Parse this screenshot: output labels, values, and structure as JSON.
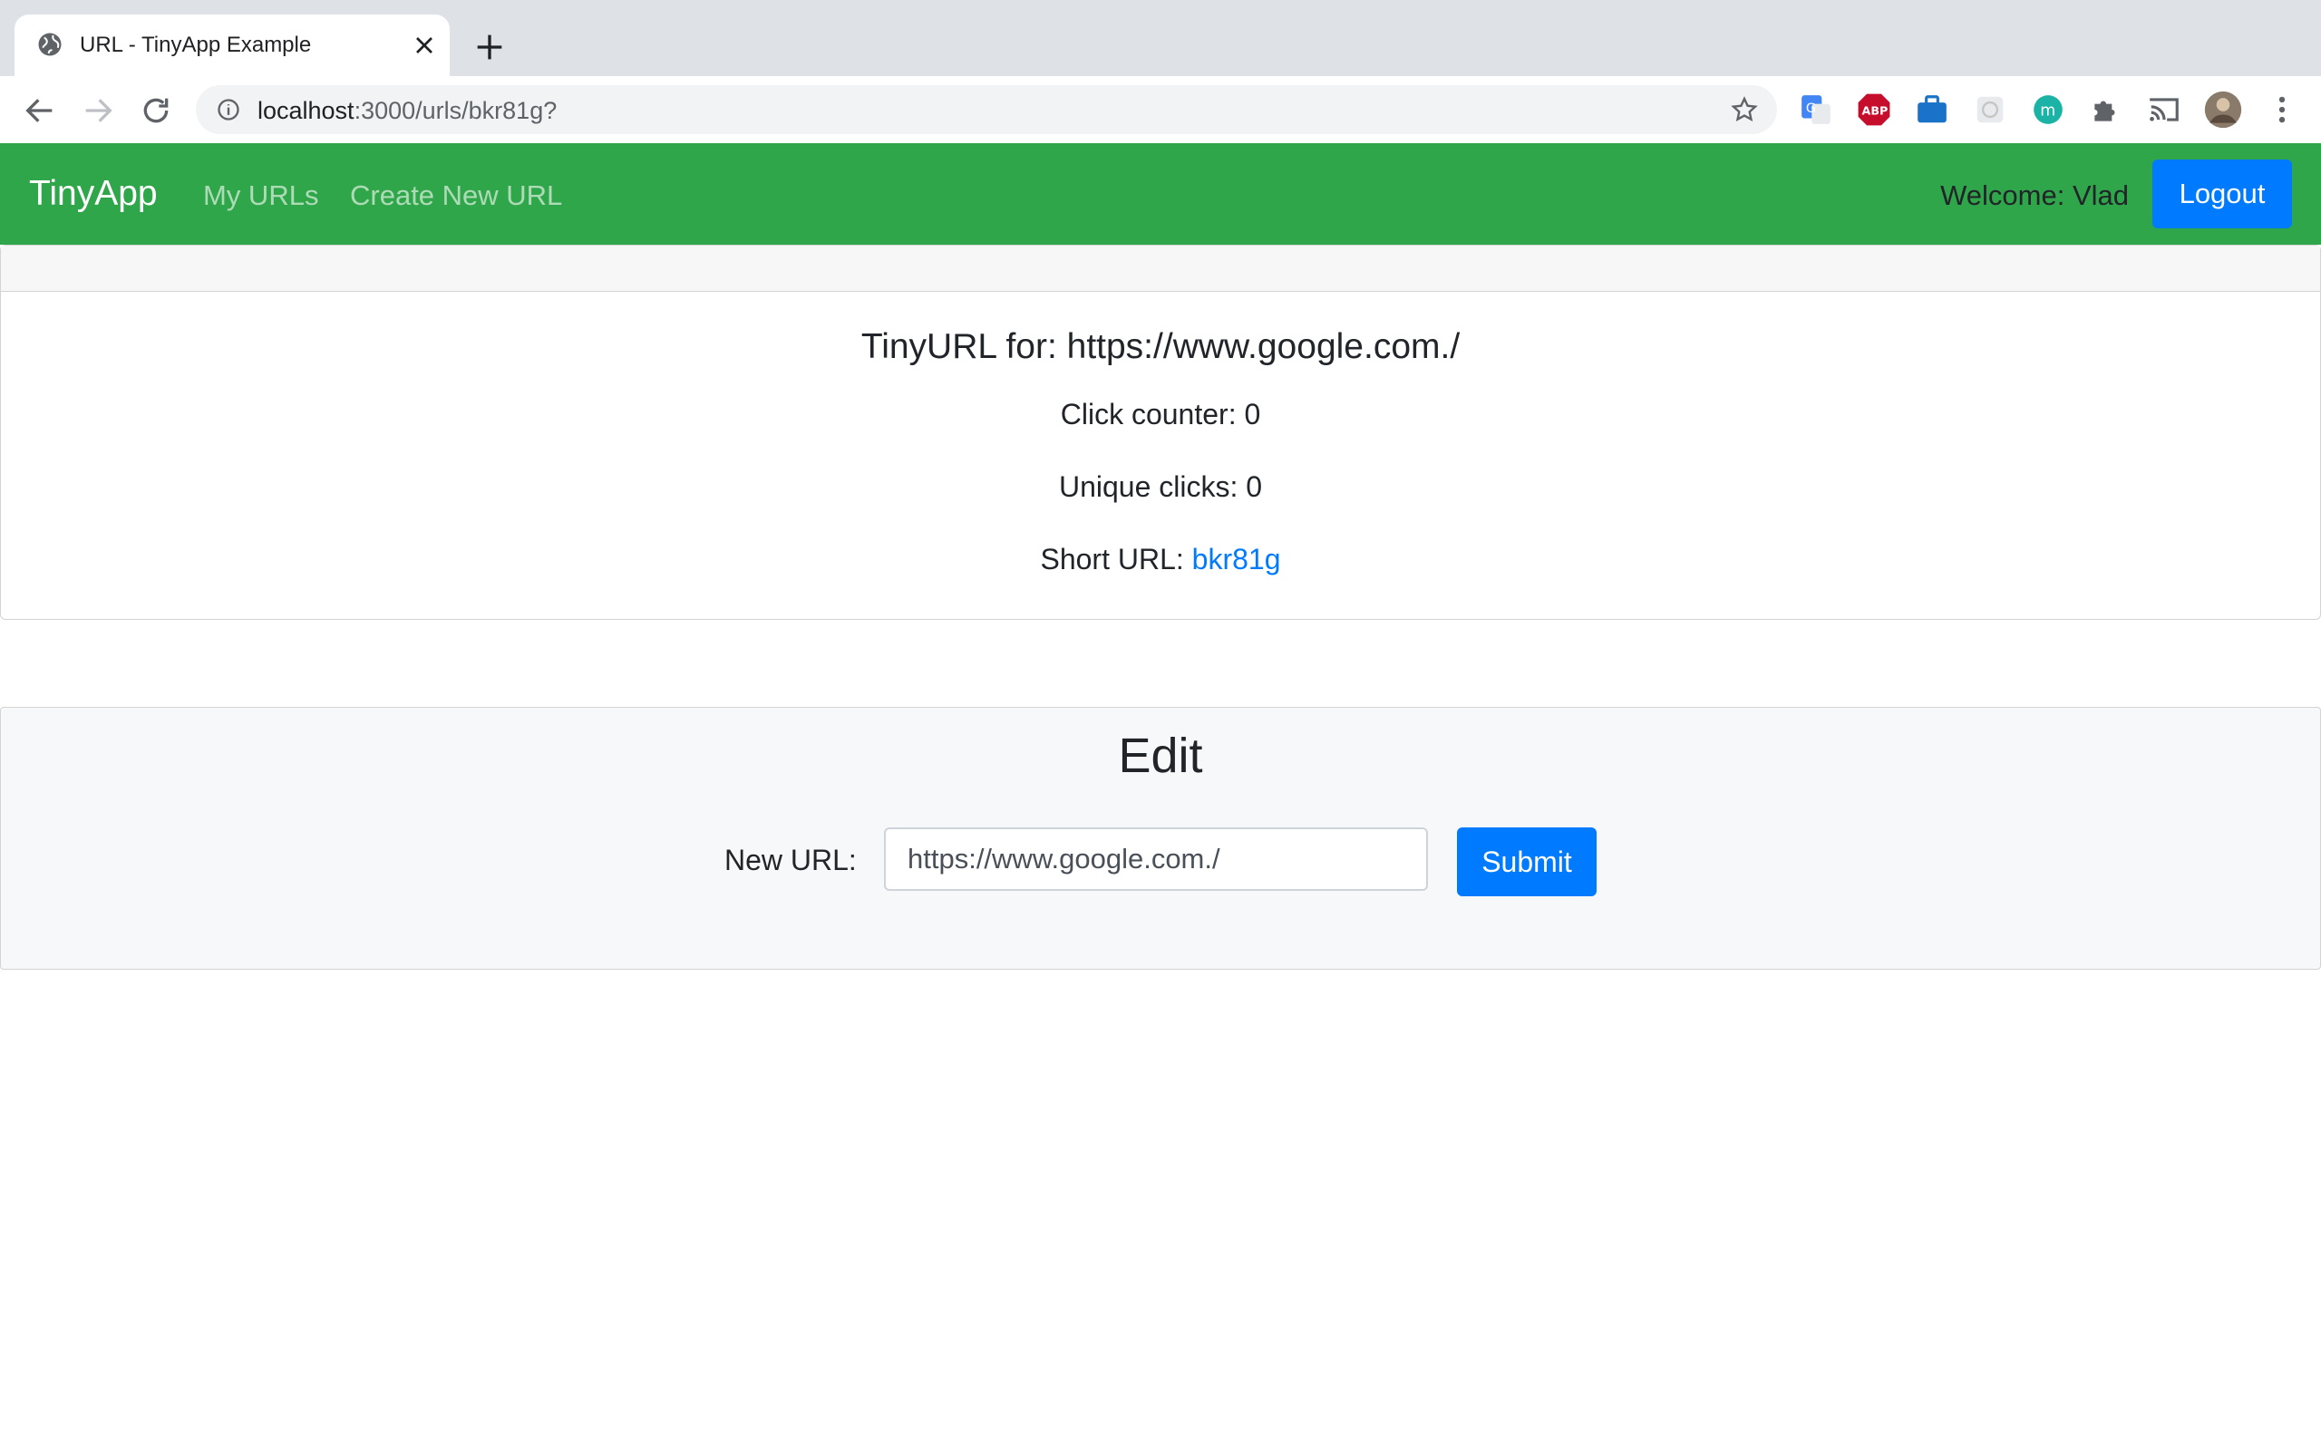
{
  "browser": {
    "tab": {
      "title": "URL - TinyApp Example",
      "favicon": "globe-icon"
    },
    "address": {
      "host": "localhost",
      "path": ":3000/urls/bkr81g?"
    },
    "extensions": [
      "google-translate-icon",
      "adblock-plus-icon",
      "toolbox-icon",
      "grid-icon",
      "m-extension-icon",
      "puzzle-icon",
      "cast-icon",
      "avatar",
      "more-vert-icon"
    ]
  },
  "navbar": {
    "brand": "TinyApp",
    "links": [
      "My URLs",
      "Create New URL"
    ],
    "welcome": "Welcome: Vlad",
    "logout_label": "Logout",
    "color": "#30a64a"
  },
  "card": {
    "title": "TinyURL for: https://www.google.com./",
    "click_counter": "Click counter: 0",
    "unique_clicks": "Unique clicks: 0",
    "short_url_label": "Short URL: ",
    "short_url": "bkr81g"
  },
  "edit": {
    "title": "Edit",
    "label": "New URL:",
    "value": "https://www.google.com./",
    "submit_label": "Submit"
  },
  "colors": {
    "primary": "#007bff"
  }
}
